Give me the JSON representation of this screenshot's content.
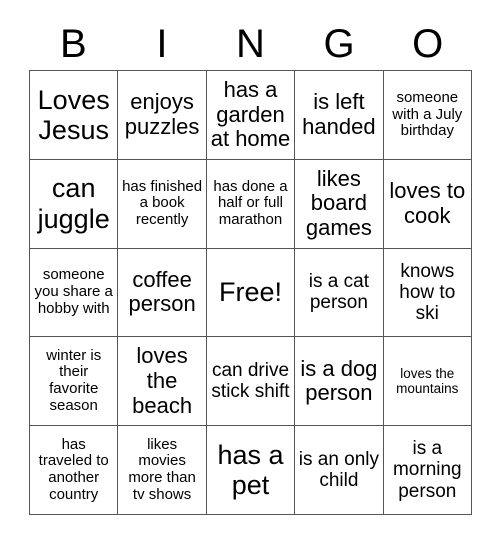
{
  "card": {
    "title": "BINGO Card",
    "headers": [
      "B",
      "I",
      "N",
      "G",
      "O"
    ],
    "free_space_label": "Free!",
    "border_color": "#555555",
    "text_color": "#000000",
    "background_color": "#ffffff",
    "rows": [
      [
        "Loves Jesus",
        "enjoys puzzles",
        "has a garden at home",
        "is left handed",
        "someone with a July birthday"
      ],
      [
        "can juggle",
        "has finished a book recently",
        "has done a half or full marathon",
        "likes board games",
        "loves to cook"
      ],
      [
        "someone you share a hobby with",
        "coffee person",
        "Free!",
        "is a cat person",
        "knows how to ski"
      ],
      [
        "winter is their favorite season",
        "loves the beach",
        "can drive stick shift",
        "is a dog person",
        "loves the mountains"
      ],
      [
        "has traveled to another country",
        "likes movies more than tv shows",
        "has a pet",
        "is an only child",
        "is a morning person"
      ]
    ]
  }
}
